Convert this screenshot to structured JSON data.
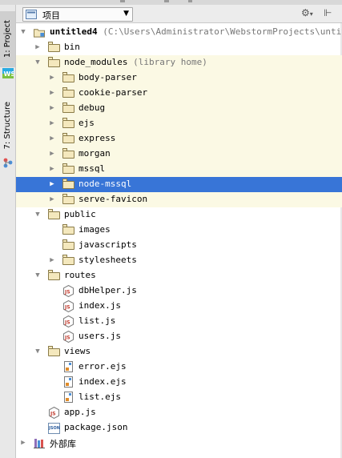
{
  "window": {
    "view_selector": {
      "label": "项目",
      "icon": "project-view-icon"
    },
    "header_buttons": [
      "settings-icon",
      "collapse-all-icon"
    ]
  },
  "toolstrip": {
    "tabs": [
      {
        "label": "1: Project",
        "icon": "project-icon",
        "active": true
      },
      {
        "label": "7: Structure",
        "icon": "structure-icon",
        "active": false
      }
    ],
    "webstorm_badge": "WS"
  },
  "tree": {
    "rows": [
      {
        "label": "untitled4",
        "hint": "(C:\\Users\\Administrator\\WebstormProjects\\untitled",
        "bold": true,
        "kind": "module",
        "expanded": true,
        "indent": 0
      },
      {
        "label": "bin",
        "kind": "folder",
        "expanded": false,
        "indent": 1
      },
      {
        "label": "node_modules",
        "hint": "(library home)",
        "kind": "folder",
        "expanded": true,
        "indent": 1,
        "lib": true
      },
      {
        "label": "body-parser",
        "kind": "folder",
        "expanded": false,
        "indent": 2,
        "lib": true
      },
      {
        "label": "cookie-parser",
        "kind": "folder",
        "expanded": false,
        "indent": 2,
        "lib": true
      },
      {
        "label": "debug",
        "kind": "folder",
        "expanded": false,
        "indent": 2,
        "lib": true
      },
      {
        "label": "ejs",
        "kind": "folder",
        "expanded": false,
        "indent": 2,
        "lib": true
      },
      {
        "label": "express",
        "kind": "folder",
        "expanded": false,
        "indent": 2,
        "lib": true
      },
      {
        "label": "morgan",
        "kind": "folder",
        "expanded": false,
        "indent": 2,
        "lib": true
      },
      {
        "label": "mssql",
        "kind": "folder",
        "expanded": false,
        "indent": 2,
        "lib": true
      },
      {
        "label": "node-mssql",
        "kind": "folder",
        "expanded": false,
        "indent": 2,
        "lib": true,
        "selected": true
      },
      {
        "label": "serve-favicon",
        "kind": "folder",
        "expanded": false,
        "indent": 2,
        "lib": true
      },
      {
        "label": "public",
        "kind": "folder",
        "expanded": true,
        "indent": 1
      },
      {
        "label": "images",
        "kind": "folder",
        "indent": 2
      },
      {
        "label": "javascripts",
        "kind": "folder",
        "indent": 2
      },
      {
        "label": "stylesheets",
        "kind": "folder",
        "expanded": false,
        "indent": 2
      },
      {
        "label": "routes",
        "kind": "folder",
        "expanded": true,
        "indent": 1
      },
      {
        "label": "dbHelper.js",
        "kind": "js",
        "indent": 2
      },
      {
        "label": "index.js",
        "kind": "js",
        "indent": 2
      },
      {
        "label": "list.js",
        "kind": "js",
        "indent": 2
      },
      {
        "label": "users.js",
        "kind": "js",
        "indent": 2
      },
      {
        "label": "views",
        "kind": "folder",
        "expanded": true,
        "indent": 1
      },
      {
        "label": "error.ejs",
        "kind": "ejs",
        "indent": 2
      },
      {
        "label": "index.ejs",
        "kind": "ejs",
        "indent": 2
      },
      {
        "label": "list.ejs",
        "kind": "ejs",
        "indent": 2
      },
      {
        "label": "app.js",
        "kind": "js",
        "indent": 1
      },
      {
        "label": "package.json",
        "kind": "json",
        "indent": 1
      },
      {
        "label": "外部库",
        "kind": "library",
        "expanded": false,
        "indent": 0
      }
    ]
  },
  "colors": {
    "selection": "#3875d7",
    "library_background": "#fbf9e4",
    "folder_fill": "#f4e8bd"
  }
}
